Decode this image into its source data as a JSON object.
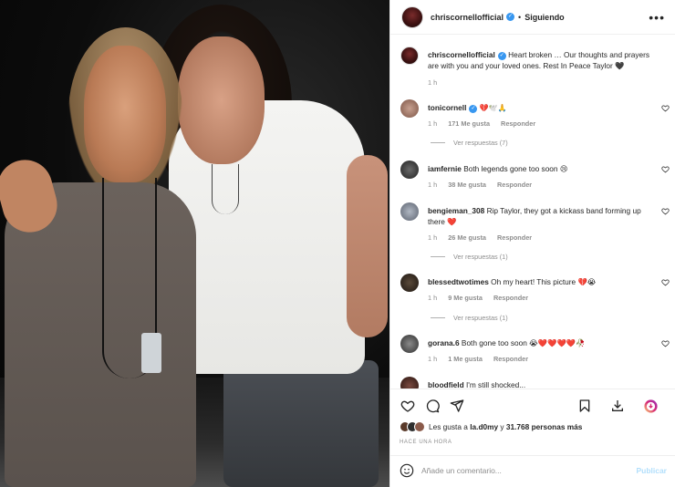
{
  "post": {
    "username": "chriscornellofficial",
    "follow_state": "Siguiendo",
    "separator": "•"
  },
  "caption": {
    "username": "chriscornellofficial",
    "text": "Heart broken … Our thoughts and prayers are with you and your loved ones. Rest In Peace Taylor 🖤",
    "time": "1 h"
  },
  "comments": [
    {
      "user": "tonicornell",
      "text": "💔🕊️🙏",
      "time": "1 h",
      "likes": "171 Me gusta",
      "reply": "Responder",
      "view_replies": "Ver respuestas (7)"
    },
    {
      "user": "iamfernie",
      "text": "Both legends gone too soon 😢",
      "time": "1 h",
      "likes": "38 Me gusta",
      "reply": "Responder"
    },
    {
      "user": "bengieman_308",
      "text": "Rip Taylor, they got a kickass band forming up there ❤️",
      "time": "1 h",
      "likes": "26 Me gusta",
      "reply": "Responder",
      "view_replies": "Ver respuestas (1)"
    },
    {
      "user": "blessedtwotimes",
      "text": "Oh my heart! This picture 💔😭",
      "time": "1 h",
      "likes": "9 Me gusta",
      "reply": "Responder",
      "view_replies": "Ver respuestas (1)"
    },
    {
      "user": "gorana.6",
      "text": "Both gone too soon 😭❤️❤️❤️❤️🥀",
      "time": "1 h",
      "likes": "1 Me gusta",
      "reply": "Responder"
    },
    {
      "user": "bloodfield",
      "text": "I'm still shocked..."
    }
  ],
  "likes": {
    "prefix": "Les gusta a ",
    "user": "la.d0my",
    "middle": " y ",
    "count": "31.768 personas más"
  },
  "posted_time": "HACE UNA HORA",
  "add_comment": {
    "placeholder": "Añade un comentario...",
    "publish": "Publicar"
  },
  "icons": {
    "heart": "heart-icon",
    "comment": "comment-icon",
    "share": "share-icon",
    "save": "bookmark-icon",
    "download": "download-icon",
    "emoji": "emoji-icon",
    "more": "more-options-icon"
  },
  "colors": {
    "verified": "#3897f0",
    "publish_disabled": "#b2dffc",
    "meta_gray": "#8e8e8e"
  }
}
